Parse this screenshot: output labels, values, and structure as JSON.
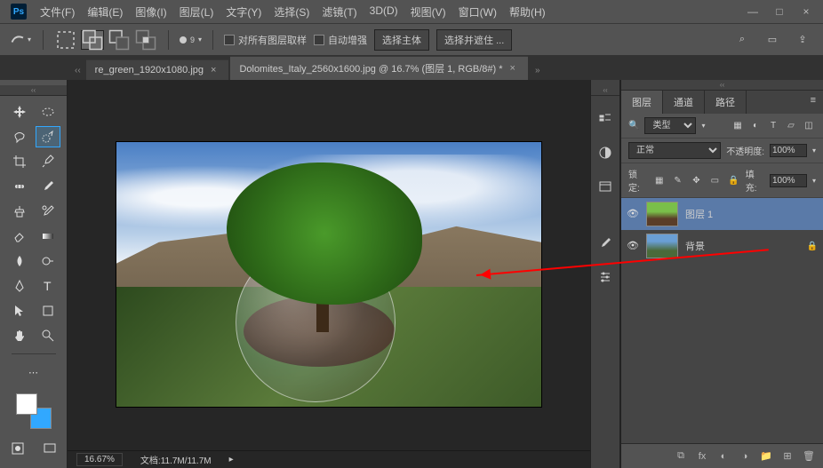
{
  "app": {
    "logo": "Ps"
  },
  "menu": [
    "文件(F)",
    "编辑(E)",
    "图像(I)",
    "图层(L)",
    "文字(Y)",
    "选择(S)",
    "滤镜(T)",
    "3D(D)",
    "视图(V)",
    "窗口(W)",
    "帮助(H)"
  ],
  "options": {
    "brush_size": "9",
    "sample_all": "对所有图层取样",
    "auto_enhance": "自动增强",
    "select_subject": "选择主体",
    "select_and_mask": "选择并遮住 ..."
  },
  "tabs": [
    {
      "label": "re_green_1920x1080.jpg",
      "close": "×",
      "active": false
    },
    {
      "label": "Dolomites_Italy_2560x1600.jpg @ 16.7% (图层 1, RGB/8#) *",
      "close": "×",
      "active": true
    }
  ],
  "status": {
    "zoom": "16.67%",
    "doc_label": "文档:",
    "doc_size": "11.7M/11.7M"
  },
  "panels": {
    "tabs": {
      "layers": "图层",
      "channels": "通道",
      "paths": "路径"
    },
    "filter_label": "类型",
    "blend_mode": "正常",
    "opacity_label": "不透明度:",
    "opacity_value": "100%",
    "lock_label": "锁定:",
    "fill_label": "填充:",
    "fill_value": "100%",
    "layers": [
      {
        "name": "图层 1",
        "locked": false
      },
      {
        "name": "背景",
        "locked": true
      }
    ]
  },
  "icons": {
    "search": "⌕",
    "frame": "▭",
    "share": "⇪",
    "minimize": "—",
    "maximize": "□",
    "close": "×",
    "chevron_down": "▾",
    "chevron_right": "▸",
    "chevron_dbl": "»",
    "eye": "👁",
    "lock": "🔒",
    "trash": "🗑",
    "folder": "📁",
    "plus": "⊞",
    "fx": "fx",
    "mask": "◐",
    "adjust": "◑",
    "link": "⧉"
  }
}
